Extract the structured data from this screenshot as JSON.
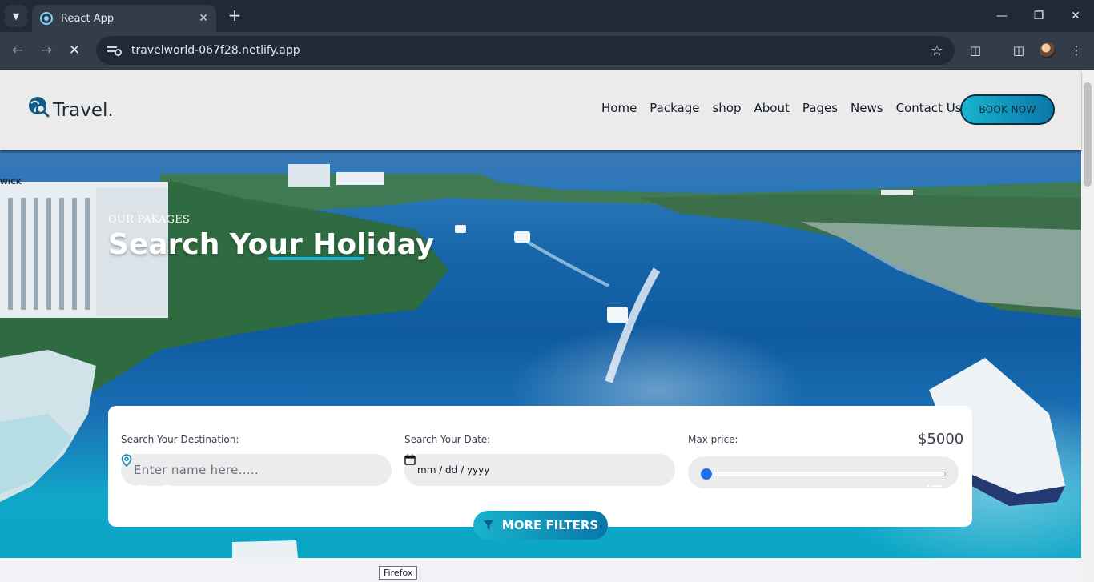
{
  "browser": {
    "tab_title": "React App",
    "url": "travelworld-067f28.netlify.app"
  },
  "header": {
    "logo_text": "Travel.",
    "nav": [
      "Home",
      "Package",
      "shop",
      "About",
      "Pages",
      "News",
      "Contact Us"
    ],
    "book_label": "BOOK NOW"
  },
  "hero": {
    "subtitle": "OUR PAKAGES",
    "title": "Search Your Holiday",
    "sign_text": "WICK"
  },
  "search": {
    "destination_label": "Search Your Destination:",
    "destination_placeholder": "Enter name here.....",
    "date_label": "Search Your Date:",
    "date_placeholder": "mm / dd / yyyy",
    "price_label": "Max price:",
    "price_value": "$5000",
    "slider_value": 0,
    "filters_label": "MORE FILTERS"
  },
  "tooltip": "Firefox",
  "colors": {
    "accent": "#19b3cf",
    "accent_dark": "#0a77a8"
  }
}
